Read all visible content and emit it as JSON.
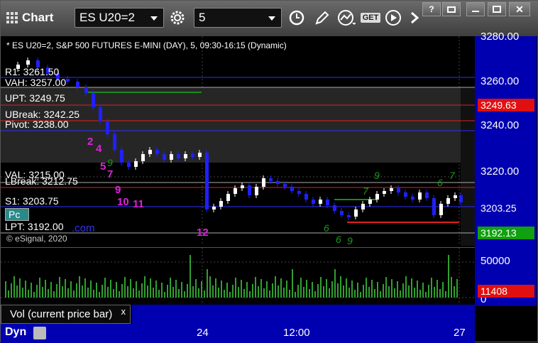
{
  "titlebar": {
    "title": "Chart",
    "symbol": "ES U20=2",
    "interval": "5",
    "get_label": "GET"
  },
  "chart": {
    "header": "* ES U20=2, S&P 500 FUTURES E-MINI (DAY), 5, 09:30-16:15 (Dynamic)",
    "copyright": "© eSignal, 2020",
    "level_labels": {
      "r1": "R1: 3261.50",
      "vah": "VAH: 3257.00",
      "upt": "UPT: 3249.75",
      "ubreak": "UBreak: 3242.25",
      "pivot": "Pivot: 3238.00",
      "val": "VAL: 3215.00",
      "lbreak": "LBreak: 3212.75",
      "s1": "S1: 3203.75",
      "lpt": "LPT: 3192.00"
    },
    "pc_label": "Pc",
    "pc_suffix": ".com",
    "counts_magenta": [
      "2",
      "4",
      "5",
      "7",
      "9",
      "10",
      "11",
      "12"
    ],
    "counts_green": [
      "9",
      "6",
      "7",
      "9",
      "6",
      "9",
      "6",
      "7"
    ]
  },
  "y_axis": {
    "ticks": [
      "3280.00",
      "3260.00",
      "3240.00",
      "3220.00"
    ],
    "tag_red": "3249.63",
    "tag_price": "3203.25",
    "tag_green": "3192.13",
    "vol_tick": "50000",
    "vol_zero": "0",
    "vol_tag": "11408"
  },
  "x_axis": {
    "labels": [
      "24",
      "12:00",
      "27"
    ]
  },
  "volume_panel": {
    "label": "Vol (current price bar)",
    "close": "x"
  },
  "footer": {
    "dyn": "Dyn"
  },
  "colors": {
    "axis_blue": "#0000b0",
    "up_candle": "#ffffff",
    "down_candle": "#2020ff",
    "red_line": "#e02020",
    "green_line": "#1a8a1a",
    "magenta": "#e020e0"
  }
}
